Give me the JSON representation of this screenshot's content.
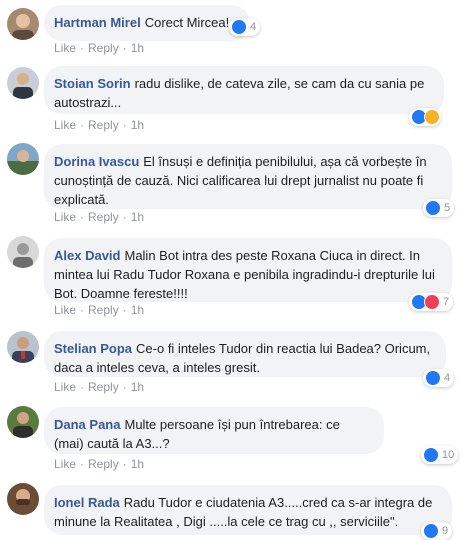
{
  "colors": {
    "author": "#385898",
    "bubble": "#f2f3f5",
    "like": "#2078f4",
    "love": "#f33e58",
    "haha": "#f7b125"
  },
  "actions": {
    "like": "Like",
    "reply": "Reply",
    "separator": "·"
  },
  "comments": [
    {
      "author": "Hartman Mirel",
      "text": "Corect Mircea!",
      "time": "1h",
      "reactions": [
        "like-icon"
      ],
      "count": "4"
    },
    {
      "author": "Stoian Sorin",
      "text": "radu dislike, de cateva zile, se cam da cu sania pe autostrazi...",
      "time": "1h",
      "reactions": [
        "like-icon",
        "haha-icon"
      ],
      "count": ""
    },
    {
      "author": "Dorina Ivascu",
      "text": "El însuși e definiția penibilului, așa că vorbește în cunoștință de cauză. Nici calificarea lui drept jurnalist nu poate fi explicată.",
      "time": "1h",
      "reactions": [
        "like-icon"
      ],
      "count": "5"
    },
    {
      "author": "Alex David",
      "text": "Malin Bot intra des peste Roxana Ciuca in direct. In mintea lui Radu Tudor Roxana e penibila ingradindu-i drepturile lui Bot. Doamne fereste!!!!",
      "time": "1h",
      "reactions": [
        "like-icon",
        "love-icon"
      ],
      "count": "7"
    },
    {
      "author": "Stelian Popa",
      "text": "Ce-o fi inteles Tudor din reactia lui Badea? Oricum, daca a inteles ceva, a inteles gresit.",
      "time": "1h",
      "reactions": [
        "like-icon"
      ],
      "count": "4"
    },
    {
      "author": "Dana Pana",
      "text": "Multe persoane își pun întrebarea: ce (mai) caută la A3...?",
      "time": "1h",
      "reactions": [
        "like-icon"
      ],
      "count": "10"
    },
    {
      "author": "Ionel Rada",
      "text": "Radu Tudor e ciudatenia A3.....cred ca s-ar integra de minune la Realitatea , Digi .....la cele ce trag cu ,, serviciile\".",
      "time": "",
      "reactions": [
        "like-icon"
      ],
      "count": "9"
    }
  ]
}
